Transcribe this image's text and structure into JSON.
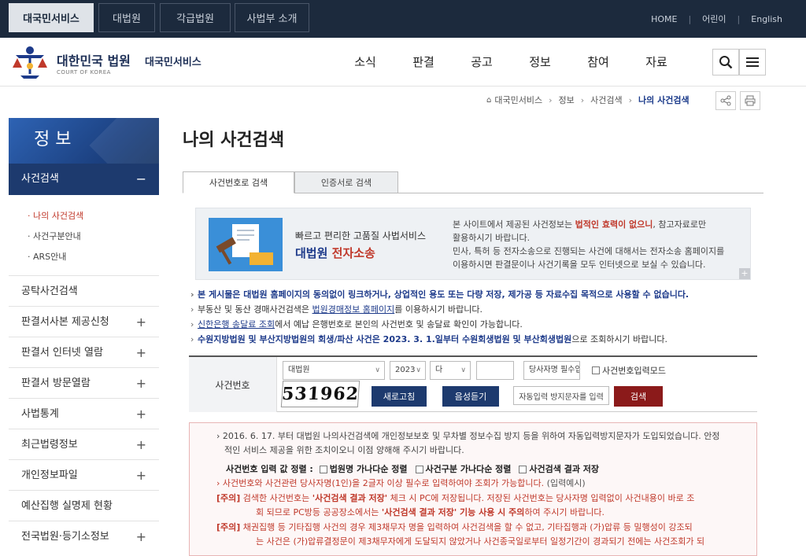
{
  "topbar": {
    "tabs": [
      "대국민서비스",
      "대법원",
      "각급법원",
      "사법부 소개"
    ],
    "active_tab": "대국민서비스",
    "links": [
      "HOME",
      "어린이",
      "English"
    ]
  },
  "header": {
    "logo_name": "대한민국 법원",
    "logo_sub": "COURT OF KOREA",
    "service_name": "대국민서비스",
    "nav": [
      "소식",
      "판결",
      "공고",
      "정보",
      "참여",
      "자료"
    ]
  },
  "breadcrumb": {
    "items": [
      "대국민서비스",
      "정보",
      "사건검색"
    ],
    "current": "나의 사건검색"
  },
  "sidebar": {
    "title": "정 보",
    "selected": {
      "label": "사건검색",
      "toggle": "−"
    },
    "sub_items": [
      "나의 사건검색",
      "사건구분안내",
      "ARS안내"
    ],
    "items": [
      {
        "label": "공탁사건검색",
        "toggle": ""
      },
      {
        "label": "판결서사본 제공신청",
        "toggle": "+"
      },
      {
        "label": "판결서 인터넷 열람",
        "toggle": "+"
      },
      {
        "label": "판결서 방문열람",
        "toggle": "+"
      },
      {
        "label": "사법통계",
        "toggle": "+"
      },
      {
        "label": "최근법령정보",
        "toggle": "+"
      },
      {
        "label": "개인정보파일",
        "toggle": "+"
      },
      {
        "label": "예산집행 실명제 현황",
        "toggle": ""
      },
      {
        "label": "전국법원·등기소정보",
        "toggle": "+"
      }
    ]
  },
  "main": {
    "page_title": "나의 사건검색",
    "tabs": [
      "사건번호로 검색",
      "인증서로 검색"
    ],
    "banner": {
      "tagline": "빠르고 편리한 고품질 사법서비스",
      "brand_a": "대법원",
      "brand_b": "전자소송",
      "desc_1a": "본 사이트에서 제공된 사건정보는 ",
      "desc_1b": "법적인 효력이 없으니",
      "desc_1c": ", 참고자료로만",
      "desc_2": "활용하시기 바랍니다.",
      "desc_3": "민사, 특허 등 전자소송으로 진행되는 사건에 대해서는 전자소송 홈페이지를",
      "desc_4": "이용하시면 판결문이나 사건기록을 모두 인터넷으로 보실 수 있습니다.",
      "plus": "+"
    },
    "notes": {
      "n1": "본 게시물은 대법원 홈페이지의 동의없이 링크하거나, 상업적인 용도 또는 다량 저장, 제가공 등 자료수집 목적으로 사용할 수 없습니다.",
      "n2a": "부동산 및 동산 경매사건검색은 ",
      "n2link": "법원경매정보 홈페이지",
      "n2b": "를 이용하시기 바랍니다.",
      "n3link": "신한은행 송달료 조회",
      "n3b": "에서 예납 은행번호로 본인의 사건번호 및 송달료 확인이 가능합니다.",
      "n4a": "수원지방법원 및 부산지방법원의 회생/파산 사건은 2023. 3. 1.일부터 수원회생법원 및 부산회생법원",
      "n4b": "으로 조회하시기 바랍니다."
    },
    "search": {
      "label": "사건번호",
      "court": "대법원",
      "year": "2023",
      "case_type": "다",
      "case_number": "",
      "party_placeholder": "당사자명 필수입",
      "case_input_mode": "사건번호입력모드",
      "captcha_text": "531962",
      "refresh_button": "새로고침",
      "audio_button": "음성듣기",
      "captcha_placeholder": "자동입력 방지문자를 입력",
      "search_button": "검색"
    },
    "notice": {
      "l1": "2016. 6. 17. 부터 대법원 나의사건검색에 개인정보보호 및 무차별 정보수집 방지 등을 위하여 자동입력방지문자가 도입되었습니다. 안정",
      "l2": "적인 서비스 제공을 위한 조치이오니 이점 양해해 주시기 바랍니다.",
      "sort_label": "사건번호 입력 값 정렬 :",
      "sort_1": "법원명 가나다순 정렬",
      "sort_2": "사건구분 가나다순 정렬",
      "sort_3": "사건검색 결과 저장",
      "l3": "사건번호와 사건관련 당사자명(1인)을 2글자 이상 필수로 입력하여야 조회가 가능합니다.",
      "l3b": " (입력예시)",
      "tag": "[주의]",
      "l4a": "검색한 사건번호는 ",
      "l4b": "'사건검색 결과 저장'",
      "l4c": " 체크 시 PC에 저장됩니다. 저장된 사건번호는 당사자명 입력없이 사건내용이 바로 조",
      "l5a": "회 되므로 PC방등 공공장소에서는 ",
      "l5b": "'사건검색 결과 저장' 기능 사용 시 주의",
      "l5c": "하여 주시기 바랍니다.",
      "l6": "채권집행 등 기타집행 사건의 경우 제3채무자 명을 입력하여 사건검색을 할 수 없고, 기타집행과 (가)압류 등 밀행성이 강조되",
      "l7": "는 사건은 (가)압류결정문이 제3채무자에게 도달되지 않았거나 사건종국일로부터 일정기간이 경과되기 전에는 사건조회가 되"
    }
  },
  "colors": {
    "topbar": "#1c2a3d",
    "sidebar_selected": "#1d3a6e",
    "accent_red": "#c0392b",
    "search_button": "#8b1a1a"
  }
}
